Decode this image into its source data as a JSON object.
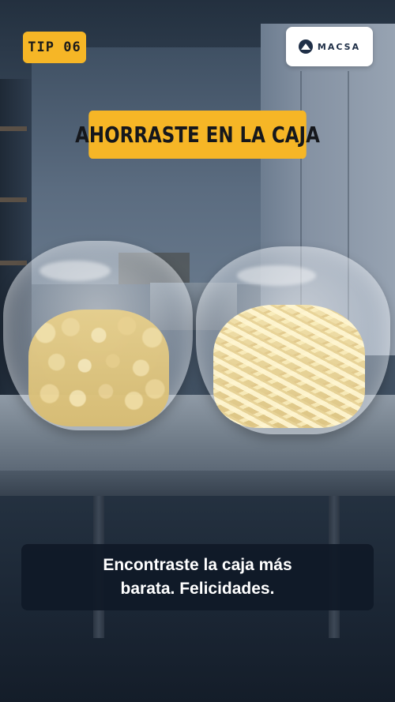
{
  "story": {
    "tip_label": "TIP 06",
    "brand_name": "MACSA",
    "brand_logo_icon": "macsa-mountain-icon",
    "headline": "AHORRASTE EN LA CAJA",
    "caption_line_1": "Encontraste la caja más",
    "caption_line_2": "barata. Felicidades.",
    "background_image": "two clear plastic bags of frozen potatoes (diced and fries) on a steel table in a cold room"
  },
  "colors": {
    "accent_yellow": "#f6b626",
    "caption_bg": "#101927",
    "brand_navy": "#1f2f47"
  }
}
